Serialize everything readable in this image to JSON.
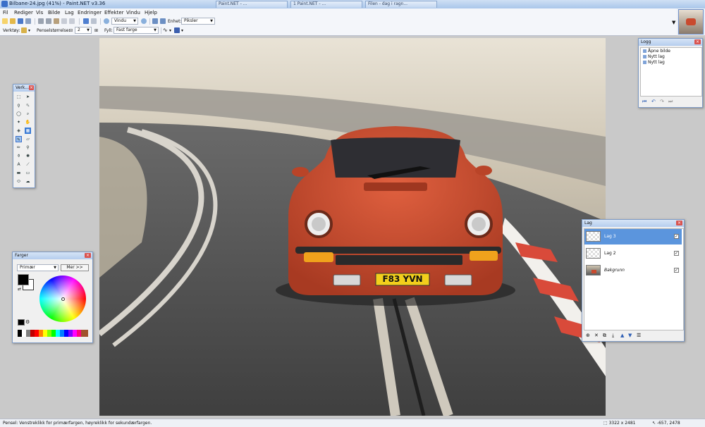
{
  "window": {
    "title": "Bilbane-24.jpg (41%) - Paint.NET v3.36"
  },
  "tabs": [
    "Paint.NET - ...",
    "1 Paint.NET - ...",
    "Filen - dag i ragn..."
  ],
  "menu": [
    "Fil",
    "Rediger",
    "Vis",
    "Bilde",
    "Lag",
    "Endringer",
    "Effekter",
    "Vindu",
    "Hjelp"
  ],
  "toolbar1": {
    "zoom_label": "Vindu",
    "unit_label": "Enhet:",
    "unit_value": "Piksler"
  },
  "toolbar2": {
    "tool_label": "Verktøy:",
    "brush_size_label": "Penselstørrelse:",
    "brush_size_value": "2",
    "fill_label": "Fyll:",
    "fill_value": "Fast farge"
  },
  "tools_window": {
    "title": "Verk..."
  },
  "colors_window": {
    "title": "Farger",
    "mode": "Primær",
    "more_button": "Mer >>"
  },
  "history_window": {
    "title": "Logg",
    "items": [
      "Åpne bilde",
      "Nytt lag",
      "Nytt lag"
    ]
  },
  "layers_window": {
    "title": "Lag",
    "layers": [
      "Lag 3",
      "Lag 2",
      "Bakgrunn"
    ]
  },
  "status": {
    "text": "Pensel: Venstreklikk for primærfargen, høyreklikk for sekundærfargen.",
    "image_size": "3322 x 2481",
    "cursor": "-657, 2478"
  },
  "plate": "F83 YVN",
  "colors": {
    "accent": "#5b95dd",
    "car": "#c94a2e"
  }
}
